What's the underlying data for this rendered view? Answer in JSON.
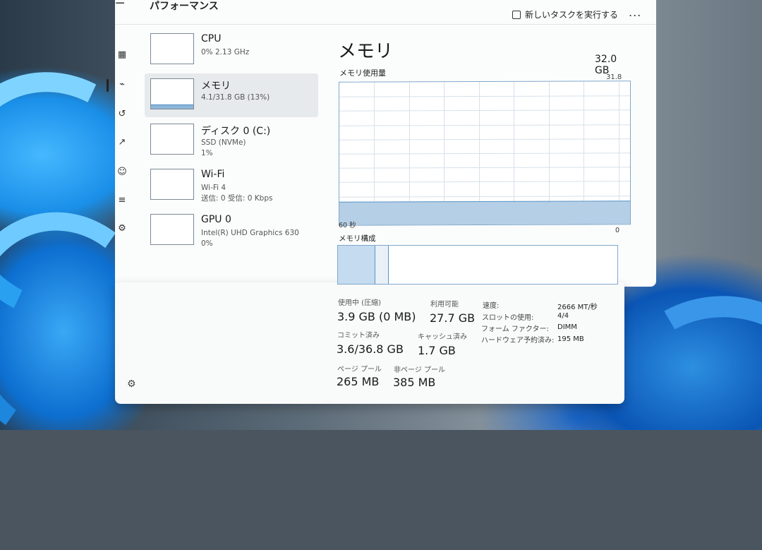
{
  "header": {
    "title": "パフォーマンス",
    "run_new_task": "新しいタスクを実行する",
    "more": "..."
  },
  "resources": [
    {
      "title": "CPU",
      "lines": [
        "0% 2.13 GHz"
      ]
    },
    {
      "title": "メモリ",
      "lines": [
        "4.1/31.8 GB (13%)"
      ]
    },
    {
      "title": "ディスク 0 (C:)",
      "lines": [
        "SSD (NVMe)",
        "1%"
      ]
    },
    {
      "title": "Wi-Fi",
      "lines": [
        "Wi-Fi 4",
        "送信: 0 受信: 0 Kbps"
      ]
    },
    {
      "title": "GPU 0",
      "lines": [
        "Intel(R) UHD Graphics 630",
        "0%"
      ]
    }
  ],
  "main": {
    "title": "メモリ",
    "total": "32.0 GB",
    "usage_label": "メモリ使用量",
    "usage_max": "31.8 GB",
    "axis_left": "60 秒",
    "axis_right": "0",
    "composition_label": "メモリ構成",
    "usage_fraction": 0.13
  },
  "stats": {
    "in_use_label": "使用中 (圧縮)",
    "in_use_value": "3.9 GB (0 MB)",
    "available_label": "利用可能",
    "available_value": "27.7 GB",
    "committed_label": "コミット済み",
    "committed_value": "3.6/36.8 GB",
    "cached_label": "キャッシュ済み",
    "cached_value": "1.7 GB",
    "paged_label": "ページ プール",
    "paged_value": "265 MB",
    "nonpaged_label": "非ページ プール",
    "nonpaged_value": "385 MB"
  },
  "specs": {
    "speed_label": "速度:",
    "speed_value": "2666 MT/秒",
    "slots_label": "スロットの使用:",
    "slots_value": "4/4",
    "form_label": "フォーム ファクター:",
    "form_value": "DIMM",
    "reserved_label": "ハードウェア予約済み:",
    "reserved_value": "195 MB"
  },
  "nav_icons": [
    "processes-icon",
    "performance-icon",
    "app-history-icon",
    "startup-apps-icon",
    "users-icon",
    "details-icon",
    "services-icon"
  ],
  "colors": {
    "graph_line": "#5b96c8",
    "graph_fill": "#b5cfe6",
    "accent": "#4a8cc6"
  }
}
